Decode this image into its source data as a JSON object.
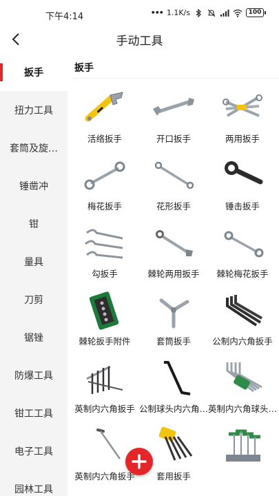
{
  "status": {
    "time": "下午4:14",
    "speed": "1.1K/s",
    "battery": "100",
    "network": "HD"
  },
  "header": {
    "title": "手动工具",
    "back_icon": "chevron-left-icon"
  },
  "sidebar": {
    "items": [
      {
        "label": "扳手",
        "active": true
      },
      {
        "label": "扭力工具"
      },
      {
        "label": "套筒及旋…"
      },
      {
        "label": "锤凿冲"
      },
      {
        "label": "钳"
      },
      {
        "label": "量具"
      },
      {
        "label": "刀剪"
      },
      {
        "label": "锯锉"
      },
      {
        "label": "防爆工具"
      },
      {
        "label": "钳工工具"
      },
      {
        "label": "电子工具"
      },
      {
        "label": "园林工具"
      }
    ]
  },
  "main": {
    "section_title": "扳手",
    "products": [
      {
        "label": "活络扳手"
      },
      {
        "label": "开口扳手"
      },
      {
        "label": "两用扳手"
      },
      {
        "label": "梅花扳手"
      },
      {
        "label": "花形扳手"
      },
      {
        "label": "锤击扳手"
      },
      {
        "label": "勾扳手"
      },
      {
        "label": "棘轮两用扳手"
      },
      {
        "label": "棘轮梅花扳手"
      },
      {
        "label": "棘轮扳手附件"
      },
      {
        "label": "套筒扳手"
      },
      {
        "label": "公制内六角扳手"
      },
      {
        "label": "英制内六角扳手"
      },
      {
        "label": "公制球头内六角…"
      },
      {
        "label": "英制内六角球头…"
      },
      {
        "label": "英制内六角扳手"
      },
      {
        "label": "套用扳手"
      },
      {
        "label": ""
      }
    ]
  },
  "fab": {
    "icon": "plus-icon"
  },
  "colors": {
    "accent": "#e4262b",
    "sidebar_bg": "#f4f4f4"
  }
}
